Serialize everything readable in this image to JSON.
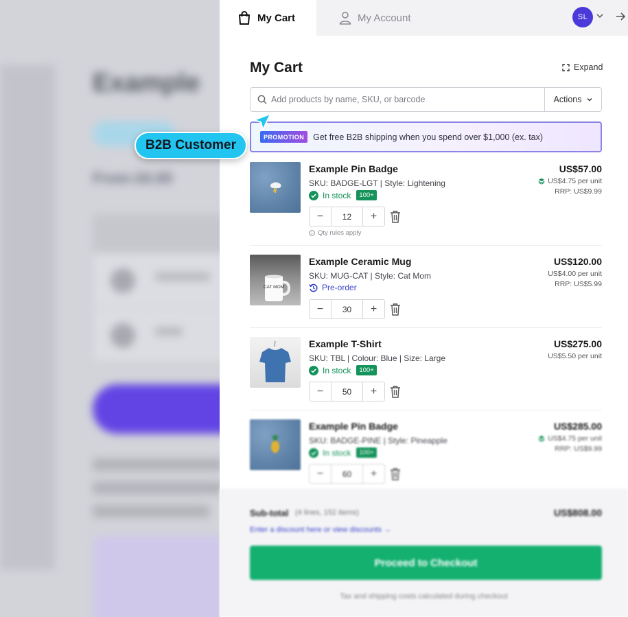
{
  "background_page": {
    "title": "Example",
    "from_price": "From £6.00"
  },
  "tabs": {
    "cart_label": "My Cart",
    "account_label": "My Account"
  },
  "user": {
    "initials": "SL"
  },
  "cart": {
    "title": "My Cart",
    "expand_label": "Expand",
    "search_placeholder": "Add products by name, SKU, or barcode",
    "actions_label": "Actions"
  },
  "promotion": {
    "badge": "PROMOTION",
    "text": "Get free B2B shipping when you spend over $1,000 (ex. tax)"
  },
  "items": [
    {
      "name": "Example Pin Badge",
      "sku": "SKU: BADGE-LGT | Style: Lightening",
      "availability": "In stock",
      "stock_badge": "100+",
      "quantity": "12",
      "qty_rules": "Qty rules apply",
      "price": "US$57.00",
      "unit_price": "US$4.75 per unit",
      "rrp": "RRP: US$9.99"
    },
    {
      "name": "Example Ceramic Mug",
      "sku": "SKU: MUG-CAT | Style: Cat Mom",
      "availability": "Pre-order",
      "quantity": "30",
      "price": "US$120.00",
      "unit_price": "US$4.00 per unit",
      "rrp": "RRP: US$5.99",
      "mug_text": "CAT MOM"
    },
    {
      "name": "Example T-Shirt",
      "sku": "SKU: TBL | Colour: Blue | Size: Large",
      "availability": "In stock",
      "stock_badge": "100+",
      "quantity": "50",
      "price": "US$275.00",
      "unit_price": "US$5.50 per unit"
    },
    {
      "name": "Example Pin Badge",
      "sku": "SKU: BADGE-PINE | Style: Pineapple",
      "availability": "In stock",
      "stock_badge": "100+",
      "quantity": "60",
      "price": "US$285.00",
      "unit_price": "US$4.75 per unit",
      "rrp": "RRP: US$9.99"
    }
  ],
  "footer": {
    "subtotal_label": "Sub-total",
    "subtotal_meta": "(4 lines, 152 items)",
    "subtotal_value": "US$808.00",
    "discount_link": "Enter a discount here or view discounts →",
    "checkout_label": "Proceed to Checkout",
    "note": "Tax and shipping costs calculated during checkout"
  },
  "callout": {
    "label": "B2B Customer"
  },
  "colors": {
    "accent": "#4a3ad9",
    "in_stock": "#14935a",
    "checkout": "#14b070",
    "callout": "#21c5ef",
    "promo_border": "#8b84e6"
  }
}
